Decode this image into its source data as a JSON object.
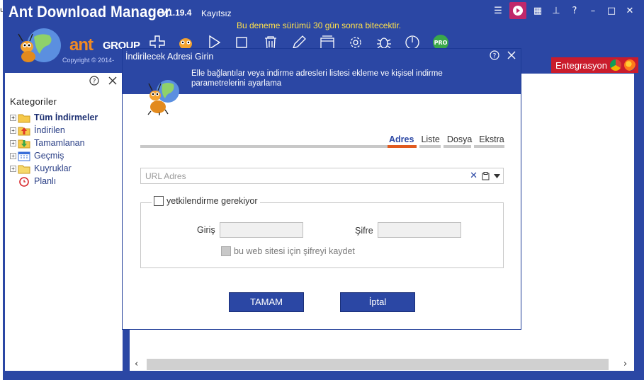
{
  "app": {
    "title": "Ant Download Manager",
    "version": "v.1.19.4",
    "license": "Kayıtsız",
    "trial_notice": "Bu deneme sürümü 30 gün sonra bitecektir.",
    "brand_ant": "ant",
    "brand_group": "GROUP",
    "copyright": "Copyright © 2014-"
  },
  "integration": {
    "label": "Entegrasyon"
  },
  "sidebar": {
    "title": "Kategoriler",
    "items": [
      {
        "label": "Tüm İndirmeler",
        "icon": "folder-icon",
        "bold": true
      },
      {
        "label": "İndirilen",
        "icon": "download-up-icon"
      },
      {
        "label": "Tamamlanan",
        "icon": "completed-icon"
      },
      {
        "label": "Geçmiş",
        "icon": "calendar-icon"
      },
      {
        "label": "Kuyruklar",
        "icon": "queue-folder-icon"
      },
      {
        "label": "Planlı",
        "icon": "alarm-clock-icon"
      }
    ]
  },
  "dialog": {
    "title": "İndirilecek Adresi Girin",
    "description": "Elle bağlantılar veya indirme adresleri listesi ekleme ve kişisel indirme parametrelerini ayarlama",
    "tabs": [
      "Adres",
      "Liste",
      "Dosya",
      "Ekstra"
    ],
    "active_tab": "Adres",
    "url_placeholder": "URL Adres",
    "auth_label": "yetkilendirme gerekiyor",
    "login_label": "Giriş",
    "password_label": "Şifre",
    "save_label": "bu web sitesi için şifreyi kaydet",
    "ok_label": "TAMAM",
    "cancel_label": "İptal"
  },
  "colors": {
    "accent": "#2b47a4",
    "tab_active": "#e05a1f",
    "integration": "#ca1c2c",
    "trial": "#ffe14a"
  }
}
